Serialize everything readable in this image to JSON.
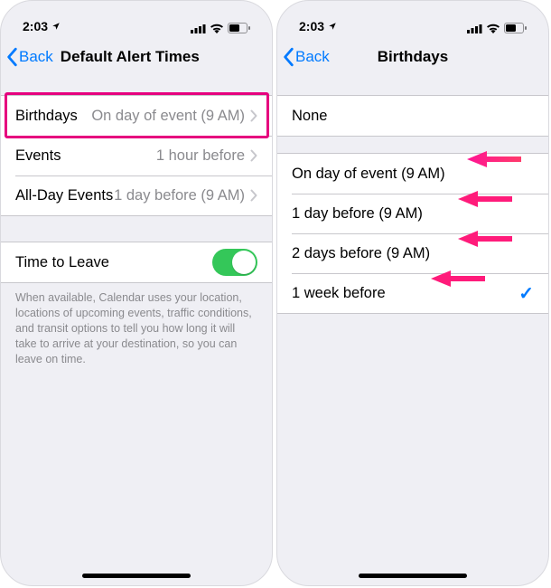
{
  "left": {
    "status_time": "2:03",
    "back_label": "Back",
    "title": "Default Alert Times",
    "rows": {
      "birthdays": {
        "label": "Birthdays",
        "value": "On day of event (9 AM)"
      },
      "events": {
        "label": "Events",
        "value": "1 hour before"
      },
      "allday": {
        "label": "All-Day Events",
        "value": "1 day before (9 AM)"
      }
    },
    "time_to_leave_label": "Time to Leave",
    "footer": "When available, Calendar uses your location, locations of upcoming events, traffic conditions, and transit options to tell you how long it will take to arrive at your destination, so you can leave on time."
  },
  "right": {
    "status_time": "2:03",
    "back_label": "Back",
    "title": "Birthdays",
    "options": {
      "none": "None",
      "on_day": "On day of event (9 AM)",
      "one_day": "1 day before (9 AM)",
      "two_days": "2 days before (9 AM)",
      "one_week": "1 week before"
    }
  }
}
